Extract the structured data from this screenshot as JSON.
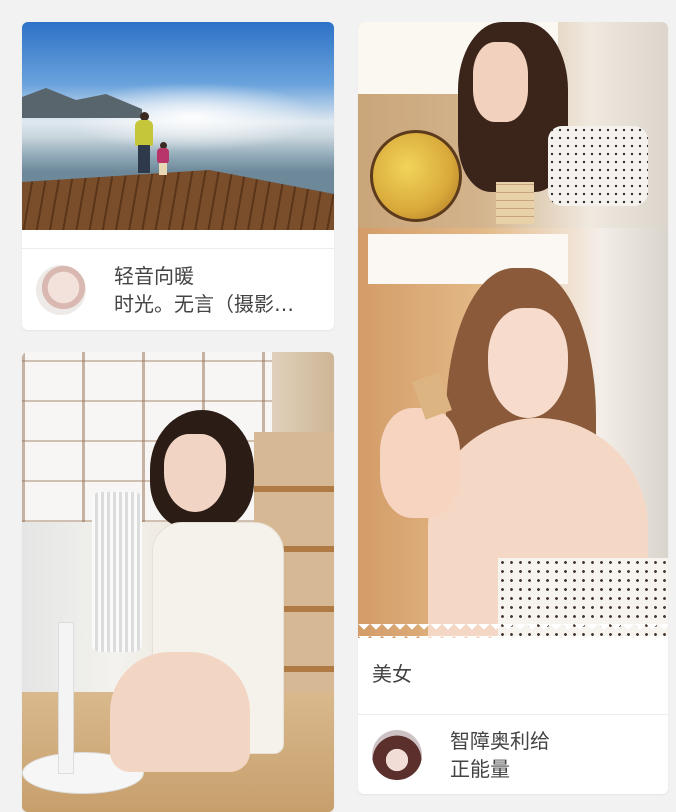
{
  "feed": {
    "cards": [
      {
        "author_lines": [
          "轻音向暖",
          "时光。无言（摄影…"
        ],
        "avatar_icon": "avatar-girl-white"
      },
      {
        "author_lines": []
      },
      {
        "caption": "美女",
        "author_lines": [
          "智障奥利给",
          "正能量"
        ],
        "avatar_icon": "avatar-anime-girl"
      }
    ]
  },
  "colors": {
    "background": "#f2f2f2",
    "card": "#ffffff",
    "text": "#444444"
  }
}
